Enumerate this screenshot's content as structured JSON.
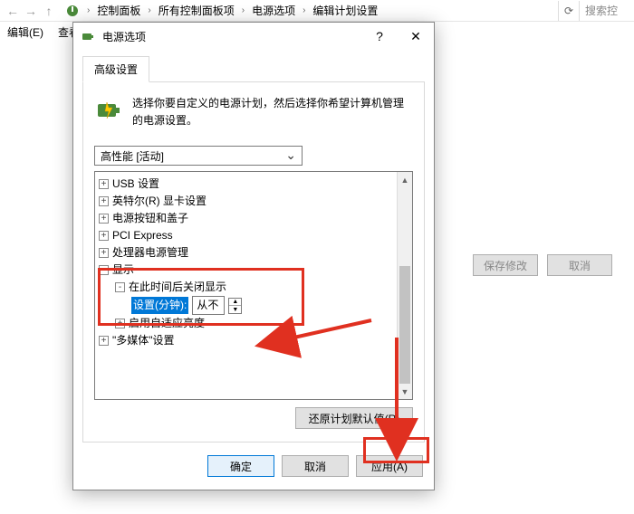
{
  "breadcrumb": {
    "items": [
      "控制面板",
      "所有控制面板项",
      "电源选项",
      "编辑计划设置"
    ]
  },
  "search": {
    "placeholder": "搜索控"
  },
  "menu": {
    "edit": "编辑(E)",
    "view": "查看"
  },
  "bg": {
    "save": "保存修改",
    "cancel": "取消"
  },
  "dialog": {
    "title": "电源选项",
    "help": "?",
    "close": "✕",
    "tab": "高级设置",
    "description": "选择你要自定义的电源计划，然后选择你希望计算机管理的电源设置。",
    "plan_selected": "高性能 [活动]",
    "tree": {
      "usb": "USB 设置",
      "intel": "英特尔(R) 显卡设置",
      "power_buttons": "电源按钮和盖子",
      "pci": "PCI Express",
      "cpu": "处理器电源管理",
      "display": "显示",
      "display_off": "在此时间后关闭显示",
      "setting_label": "设置(分钟):",
      "setting_value": "从不",
      "adaptive": "启用自适应亮度",
      "multimedia": "\"多媒体\"设置"
    },
    "restore": "还原计划默认值(R)",
    "ok": "确定",
    "cancel": "取消",
    "apply": "应用(A)"
  }
}
